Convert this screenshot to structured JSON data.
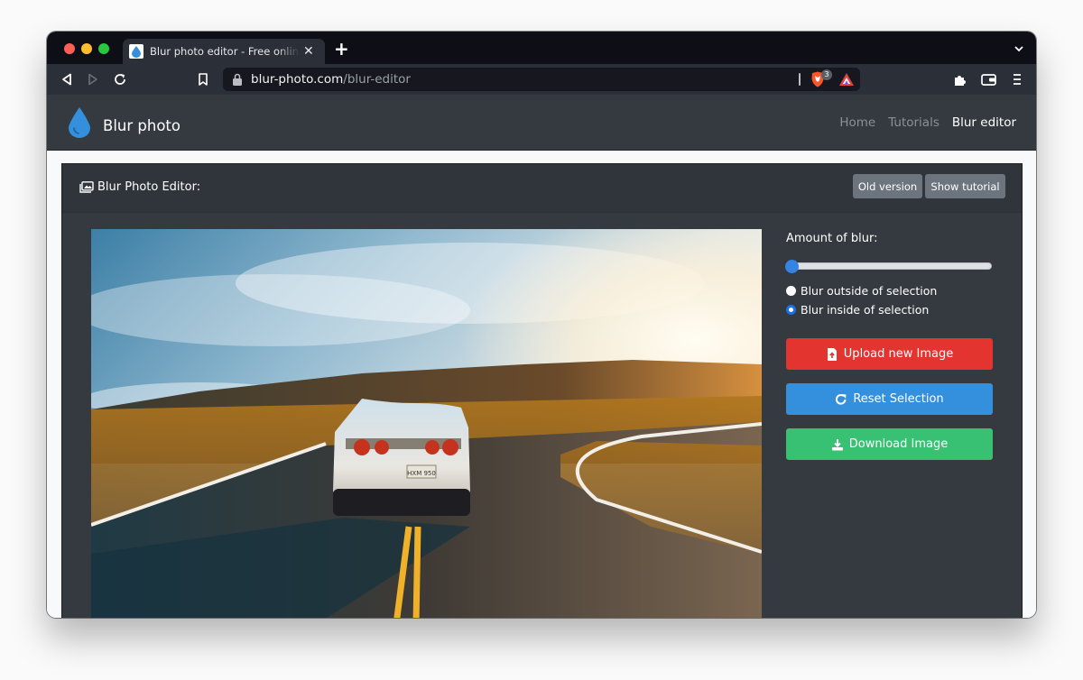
{
  "browser": {
    "tab": {
      "title": "Blur photo editor - Free online tool",
      "favicon": "water-drop-icon"
    },
    "new_tab_label": "+",
    "url": {
      "host": "blur-photo.com",
      "path": "/blur-editor"
    },
    "shields_count": "3",
    "toolbar_icons": [
      "back-icon",
      "forward-icon",
      "reload-icon",
      "bookmark-icon",
      "brave-shields-icon",
      "brave-rewards-icon",
      "extensions-icon",
      "wallet-icon",
      "menu-icon"
    ]
  },
  "site": {
    "brand": {
      "name": "Blur photo",
      "icon": "water-drop-icon",
      "color": "#3490dc"
    },
    "nav": [
      {
        "label": "Home",
        "active": false
      },
      {
        "label": "Tutorials",
        "active": false
      },
      {
        "label": "Blur editor",
        "active": true
      }
    ],
    "editor": {
      "title": "Blur Photo Editor:",
      "header_buttons": {
        "old_version": "Old version",
        "show_tutorial": "Show tutorial"
      },
      "photo": {
        "description": "White sports car on a winding road at sunset",
        "plate": "HXM 950"
      },
      "blur_label": "Amount of blur:",
      "blur_amount": 0,
      "modes": [
        {
          "label": "Blur outside of selection",
          "checked": false
        },
        {
          "label": "Blur inside of selection",
          "checked": true
        }
      ],
      "buttons": {
        "upload": "Upload new Image",
        "reset": "Reset Selection",
        "download": "Download Image"
      },
      "colors": {
        "upload": "#e3342f",
        "reset": "#3490dc",
        "download": "#38c172",
        "secondary": "#6c757d"
      }
    }
  }
}
